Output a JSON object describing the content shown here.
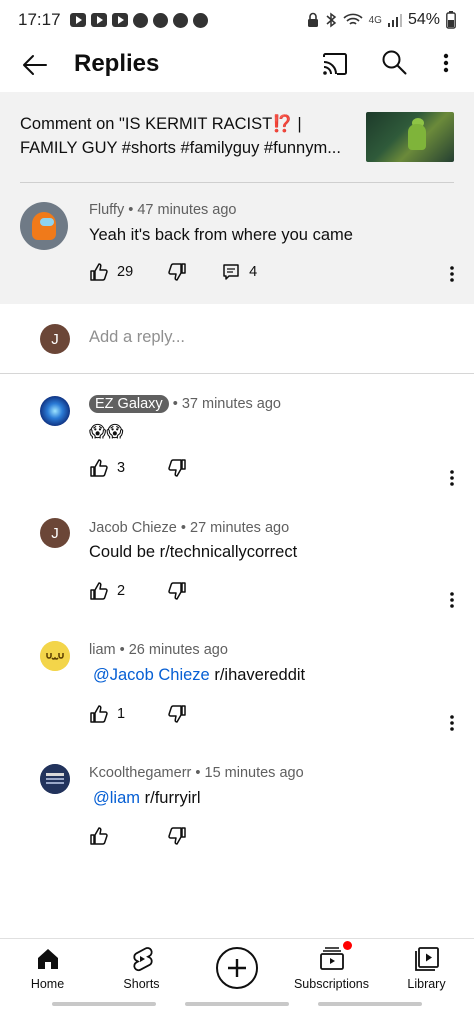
{
  "status_bar": {
    "time": "17:17",
    "network": "4G",
    "battery": "54%"
  },
  "app_bar": {
    "title": "Replies"
  },
  "context": {
    "header": "Comment on \"IS KERMIT RACIST⁉️ | FAMILY GUY #shorts #familyguy #funnym...",
    "parent": {
      "author": "Fluffy",
      "age": "47 minutes ago",
      "text": "Yeah it's back from where you came",
      "likes": "29",
      "replies": "4"
    }
  },
  "add_reply": {
    "avatar_letter": "J",
    "placeholder": "Add a reply..."
  },
  "replies": [
    {
      "author": "EZ Galaxy",
      "age": "37 minutes ago",
      "text": "😱😱",
      "likes": "3"
    },
    {
      "author": "Jacob Chieze",
      "avatar_letter": "J",
      "age": "27 minutes ago",
      "text": "Could be r/technicallycorrect",
      "likes": "2"
    },
    {
      "author": "liam",
      "age": "26 minutes ago",
      "mention": "@Jacob Chieze",
      "text": "r/ihavereddit",
      "likes": "1"
    },
    {
      "author": "Kcoolthegamerr",
      "age": "15 minutes ago",
      "mention": "@liam",
      "text": "r/furryirl",
      "likes": ""
    }
  ],
  "bottom_nav": {
    "home": "Home",
    "shorts": "Shorts",
    "subscriptions": "Subscriptions",
    "library": "Library"
  },
  "colors": {
    "accent_link": "#065fd4",
    "notification": "#ff0000",
    "context_bg": "#f2f2f2"
  },
  "separator": "•"
}
